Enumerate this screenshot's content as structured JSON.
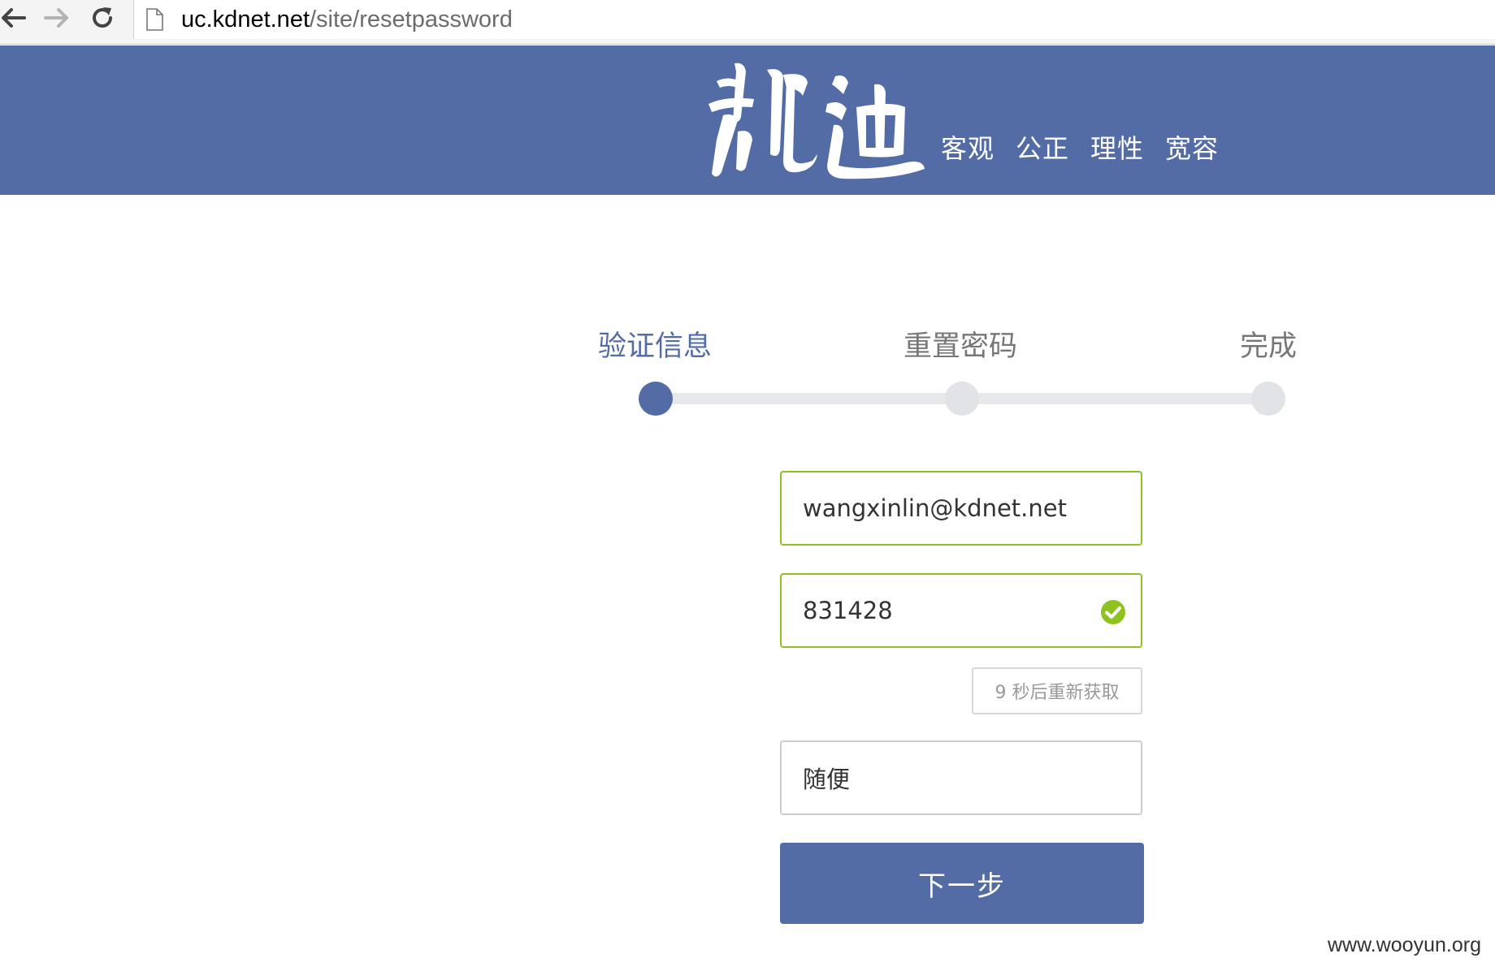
{
  "browser": {
    "url_domain": "uc.kdnet.net",
    "url_path": "/site/resetpassword"
  },
  "header": {
    "logo_text": "凯迪",
    "slogans": [
      "客观",
      "公正",
      "理性",
      "宽容"
    ],
    "background": "#536ca6"
  },
  "steps": {
    "items": [
      "验证信息",
      "重置密码",
      "完成"
    ],
    "active_index": 0,
    "active_color": "#536ca6"
  },
  "form": {
    "email_value": "wangxinlin@kdnet.net",
    "code_value": "831428",
    "resend_label": "9 秒后重新获取",
    "extra_value": "随便",
    "next_label": "下一步",
    "valid_color": "#8ec31f"
  },
  "watermark": "www.wooyun.org"
}
